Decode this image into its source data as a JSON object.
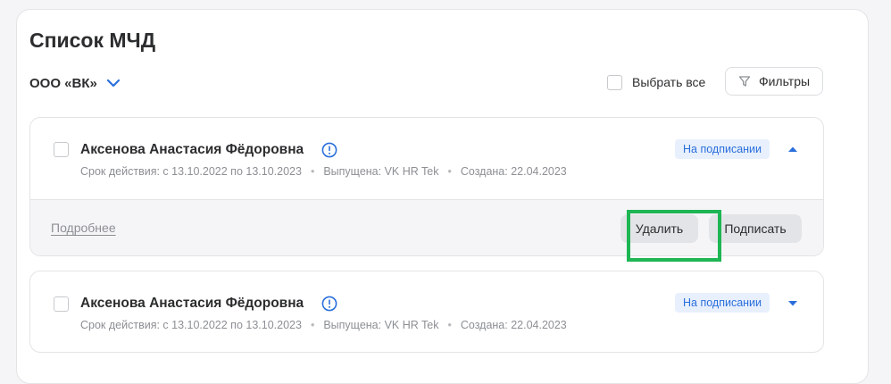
{
  "page_title": "Список МЧД",
  "organization": {
    "selected": "ООО «ВК»",
    "icon": "chevron-down-icon"
  },
  "toolbar": {
    "select_all_label": "Выбрать все",
    "filters_label": "Фильтры",
    "filters_icon": "filter-icon"
  },
  "cards": [
    {
      "name": "Аксенова Анастасия Фёдоровна",
      "validity": "Срок действия: с 13.10.2022 по 13.10.2023",
      "issued_by": "Выпущена: VK HR Tek",
      "created": "Создана: 22.04.2023",
      "status": "На подписании",
      "expanded": true,
      "details_link": "Подробнее",
      "delete_label": "Удалить",
      "sign_label": "Подписать"
    },
    {
      "name": "Аксенова Анастасия Фёдоровна",
      "validity": "Срок действия: с 13.10.2022 по 13.10.2023",
      "issued_by": "Выпущена: VK HR Tek",
      "created": "Создана: 22.04.2023",
      "status": "На подписании",
      "expanded": false
    }
  ],
  "colors": {
    "accent": "#2a6fdb",
    "status_bg": "#e8f0fd",
    "highlight": "#1eb554",
    "muted_text": "#8c8f94"
  }
}
